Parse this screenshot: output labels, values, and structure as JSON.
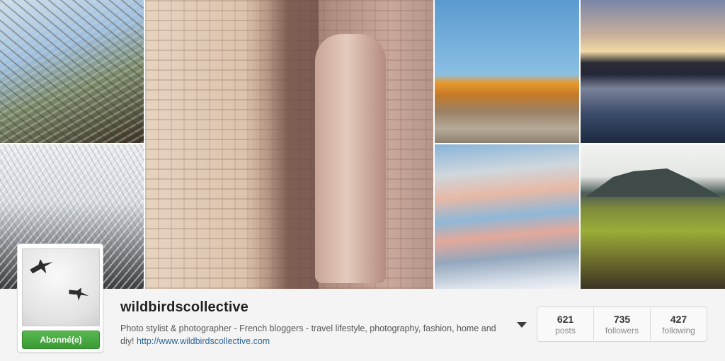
{
  "profile": {
    "username": "wildbirdscollective",
    "bio_text": "Photo stylist & photographer - French bloggers - travel lifestyle, photography, fashion, home and diy!",
    "website": "http://www.wildbirdscollective.com",
    "follow_button_label": "Abonné(e)",
    "follow_button_color": "#4aa945"
  },
  "stats": [
    {
      "value": "621",
      "label": "posts"
    },
    {
      "value": "735",
      "label": "followers"
    },
    {
      "value": "427",
      "label": "following"
    }
  ],
  "photos": [
    "winter-tree-photo",
    "temple-statue-photo",
    "desert-canyon-photo",
    "sunset-lake-photo",
    "snowy-tree-photo",
    "pastel-clouds-photo",
    "mountain-field-photo"
  ],
  "icons": {
    "options": "chevron-down-icon"
  }
}
